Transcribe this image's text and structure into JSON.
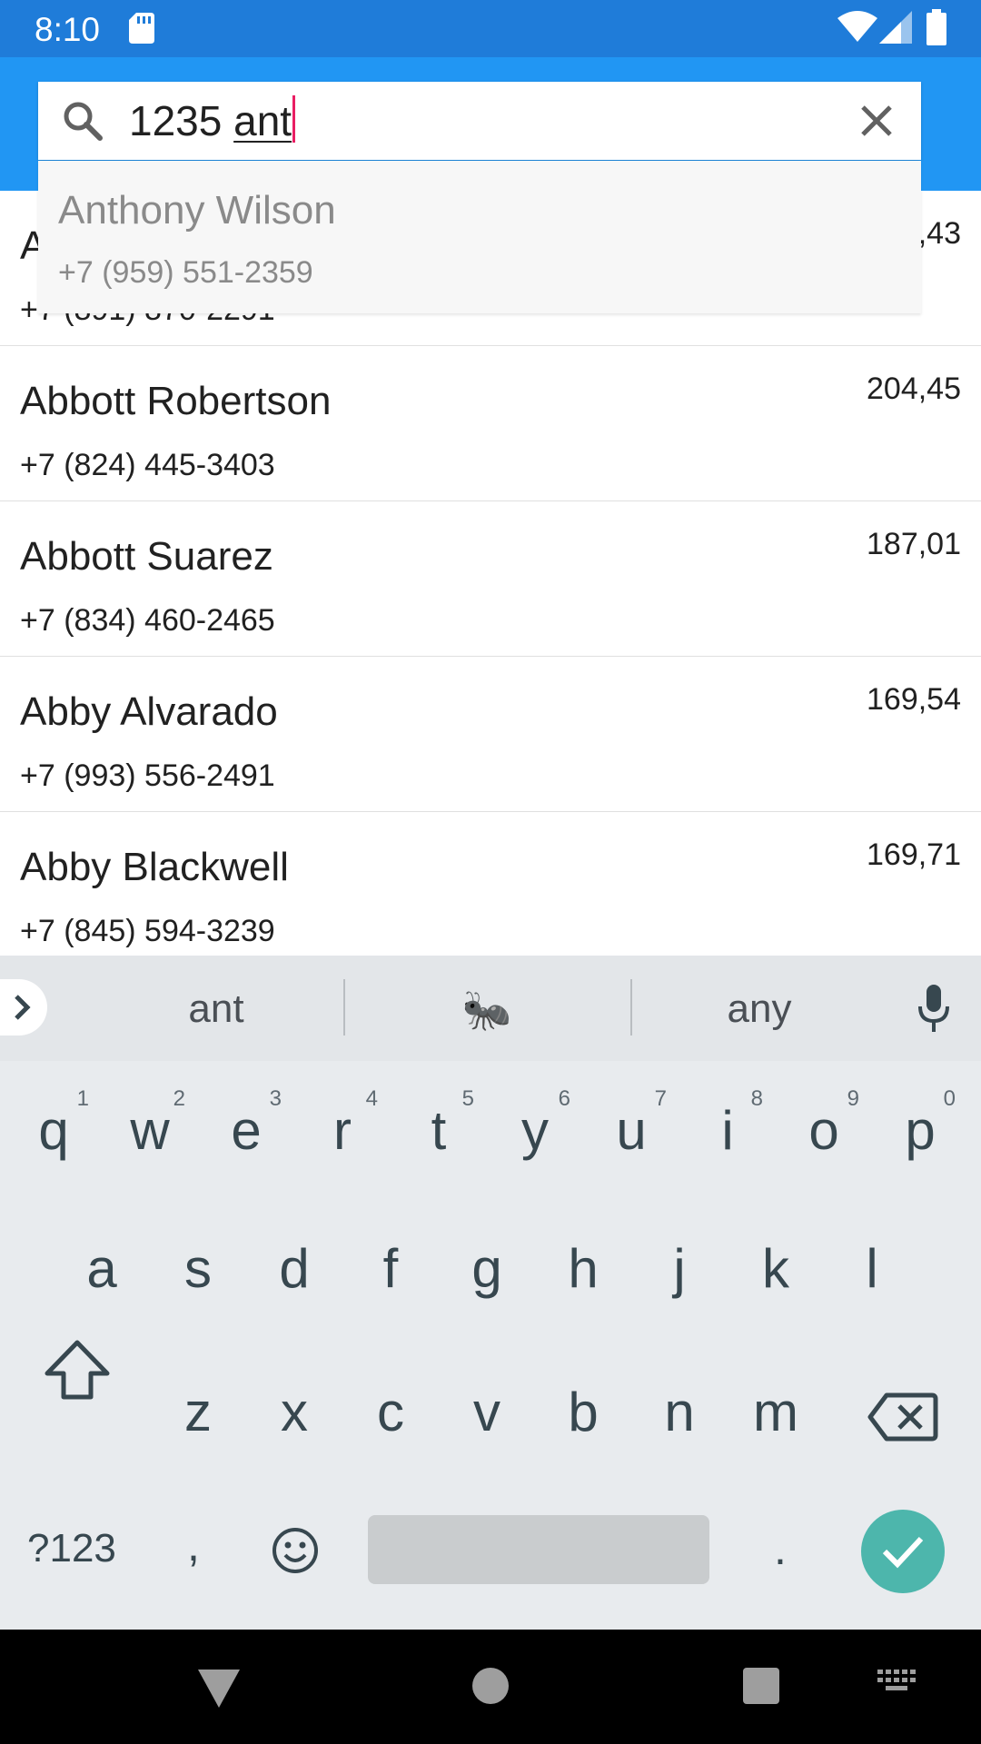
{
  "status_bar": {
    "time": "8:10",
    "icons": [
      "sd-card-icon",
      "wifi-icon",
      "signal-icon",
      "battery-icon"
    ]
  },
  "search": {
    "typed_text": "1235 ",
    "composing_text": "ant",
    "icons": [
      "search-icon",
      "clear-icon"
    ]
  },
  "suggestion": {
    "name": "Anthony Wilson",
    "phone": "+7 (959) 551-2359"
  },
  "contacts": [
    {
      "name": "A",
      "phone": "+7 (891) 870-2291",
      "amount": ",43"
    },
    {
      "name": "Abbott Robertson",
      "phone": "+7 (824) 445-3403",
      "amount": "204,45"
    },
    {
      "name": "Abbott Suarez",
      "phone": "+7 (834) 460-2465",
      "amount": "187,01"
    },
    {
      "name": "Abby Alvarado",
      "phone": "+7 (993) 556-2491",
      "amount": "169,54"
    },
    {
      "name": "Abby Blackwell",
      "phone": "+7 (845) 594-3239",
      "amount": "169,71"
    }
  ],
  "keyboard": {
    "suggestions": [
      "ant",
      "🐜",
      "any"
    ],
    "row1": [
      {
        "k": "q",
        "h": "1"
      },
      {
        "k": "w",
        "h": "2"
      },
      {
        "k": "e",
        "h": "3"
      },
      {
        "k": "r",
        "h": "4"
      },
      {
        "k": "t",
        "h": "5"
      },
      {
        "k": "y",
        "h": "6"
      },
      {
        "k": "u",
        "h": "7"
      },
      {
        "k": "i",
        "h": "8"
      },
      {
        "k": "o",
        "h": "9"
      },
      {
        "k": "p",
        "h": "0"
      }
    ],
    "row2": [
      "a",
      "s",
      "d",
      "f",
      "g",
      "h",
      "j",
      "k",
      "l"
    ],
    "row3": [
      "z",
      "x",
      "c",
      "v",
      "b",
      "n",
      "m"
    ],
    "symbols_label": "?123",
    "comma": ",",
    "period": ".",
    "colors": {
      "done": "#4db6ac",
      "background": "#e8ebee"
    }
  },
  "colors": {
    "status_bar": "#1f7cd9",
    "app_bar": "#2196f3",
    "cursor": "#e91e63"
  }
}
